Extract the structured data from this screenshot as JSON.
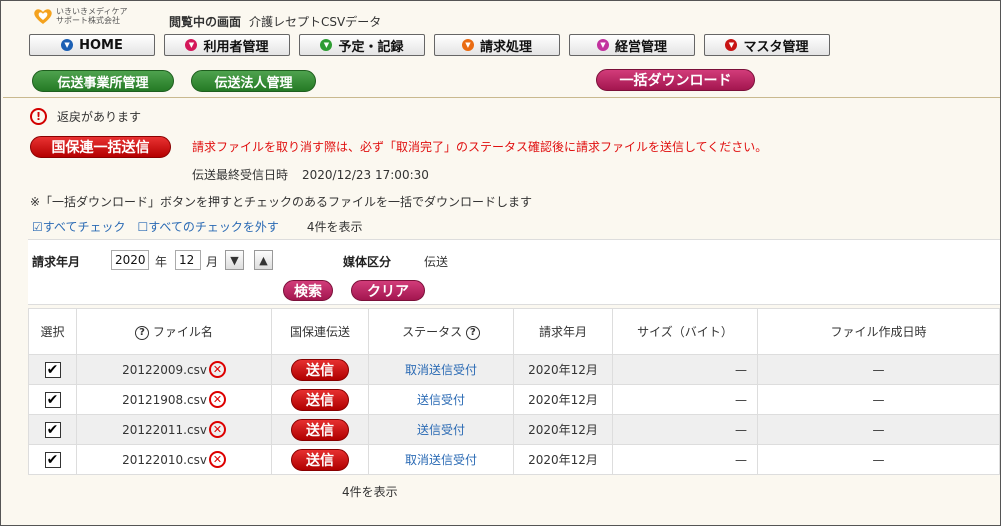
{
  "header": {
    "logo_line1": "いきいきメディケア",
    "logo_line2": "サポート株式会社",
    "viewing_label": "閲覧中の画面",
    "viewing_value": "介護レセプトCSVデータ"
  },
  "nav": [
    {
      "label": "HOME",
      "icon": "home-dot-icon",
      "color": "#1b5fb4"
    },
    {
      "label": "利用者管理",
      "icon": "users-dot-icon",
      "color": "#d4175a"
    },
    {
      "label": "予定・記録",
      "icon": "schedule-dot-icon",
      "color": "#2e9d33"
    },
    {
      "label": "請求処理",
      "icon": "billing-dot-icon",
      "color": "#ea6b12"
    },
    {
      "label": "経営管理",
      "icon": "management-dot-icon",
      "color": "#c2329e"
    },
    {
      "label": "マスタ管理",
      "icon": "master-dot-icon",
      "color": "#c81414"
    }
  ],
  "subnav": {
    "office_mgmt": "伝送事業所管理",
    "corp_mgmt": "伝送法人管理",
    "bulk_download": "一括ダウンロード"
  },
  "alerts": {
    "returned": "返戻があります",
    "bulk_send": "国保連一括送信",
    "notice": "請求ファイルを取り消す際は、必ず「取消完了」のステータス確認後に請求ファイルを送信してください。",
    "last_received_label": "伝送最終受信日時",
    "last_received_value": "2020/12/23 17:00:30",
    "help_note": "※「一括ダウンロード」ボタンを押すとチェックのあるファイルを一括でダウンロードします",
    "check_all": "☑すべてチェック",
    "uncheck_all": "☐すべてのチェックを外す",
    "count_top": "4件を表示"
  },
  "search": {
    "billing_month_label": "請求年月",
    "year_value": "2020",
    "year_unit": "年",
    "month_value": "12",
    "month_unit": "月",
    "media_label": "媒体区分",
    "media_value": "伝送",
    "search_btn": "検索",
    "clear_btn": "クリア"
  },
  "table": {
    "headers": {
      "select": "選択",
      "filename": "ファイル名",
      "send": "国保連伝送",
      "status": "ステータス",
      "month": "請求年月",
      "size": "サイズ（バイト）",
      "created": "ファイル作成日時"
    },
    "rows": [
      {
        "checked": "✔",
        "filename": "20122009.csv",
        "send": "送信",
        "status": "取消送信受付",
        "month": "2020年12月",
        "size": "—",
        "created": "—"
      },
      {
        "checked": "✔",
        "filename": "20121908.csv",
        "send": "送信",
        "status": "送信受付",
        "month": "2020年12月",
        "size": "—",
        "created": "—"
      },
      {
        "checked": "✔",
        "filename": "20122011.csv",
        "send": "送信",
        "status": "送信受付",
        "month": "2020年12月",
        "size": "—",
        "created": "—"
      },
      {
        "checked": "✔",
        "filename": "20122010.csv",
        "send": "送信",
        "status": "取消送信受付",
        "month": "2020年12月",
        "size": "—",
        "created": "—"
      }
    ],
    "count_bottom": "4件を表示"
  }
}
